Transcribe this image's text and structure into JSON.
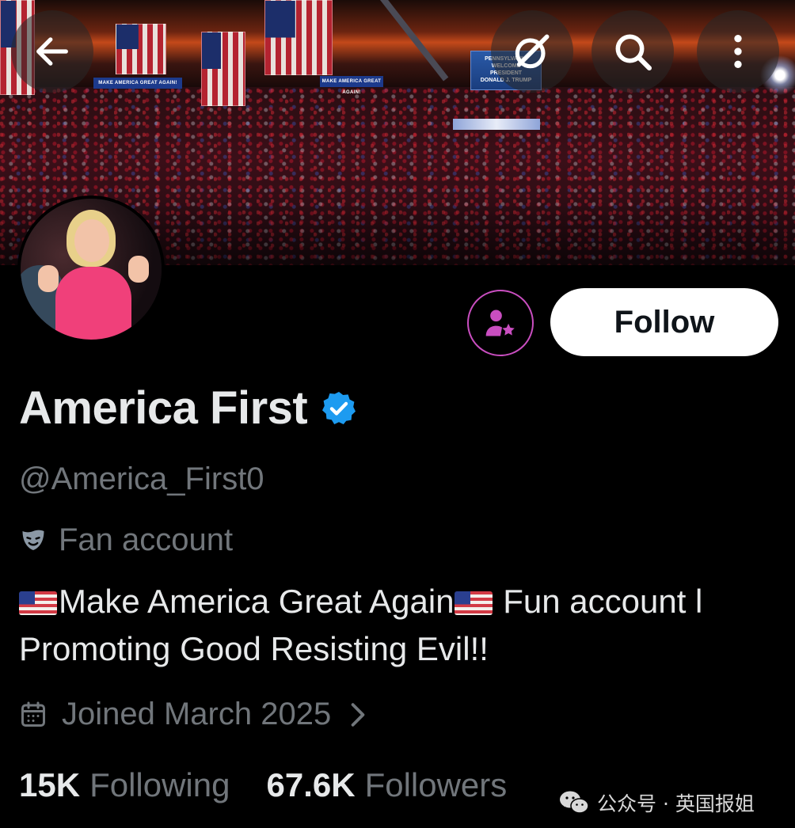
{
  "header": {
    "back_icon": "arrow-left-icon",
    "grok_icon": "grok-icon",
    "search_icon": "search-icon",
    "more_icon": "more-vertical-icon",
    "banner_sign_text": "MAKE AMERICA GREAT AGAIN!",
    "banner_billboard_lines": [
      "PENNSYLVANIA",
      "WELCOME",
      "PRESIDENT",
      "DONALD J. TRUMP"
    ]
  },
  "profile": {
    "display_name": "America First",
    "verified": true,
    "verified_color": "#1d9bf0",
    "handle": "@America_First0",
    "label_icon": "theater-mask-icon",
    "label": "Fan account",
    "bio_line_1_part_1": "Make America Great Again",
    "bio_line_1_part_2": " Fun account l",
    "bio_line_2": "Promoting Good Resisting Evil!!",
    "joined_icon": "calendar-icon",
    "joined": "Joined March 2025",
    "following_count": "15K",
    "following_label": "Following",
    "followers_count": "67.6K",
    "followers_label": "Followers"
  },
  "actions": {
    "subscribe_icon": "person-star-icon",
    "subscribe_color": "#c94ec0",
    "follow_label": "Follow"
  },
  "watermark": {
    "icon": "wechat-icon",
    "text": "公众号 · 英国报姐"
  },
  "colors": {
    "background": "#000000",
    "primary_text": "#e7e9ea",
    "secondary_text": "#71767b",
    "follow_button_bg": "#ffffff"
  }
}
